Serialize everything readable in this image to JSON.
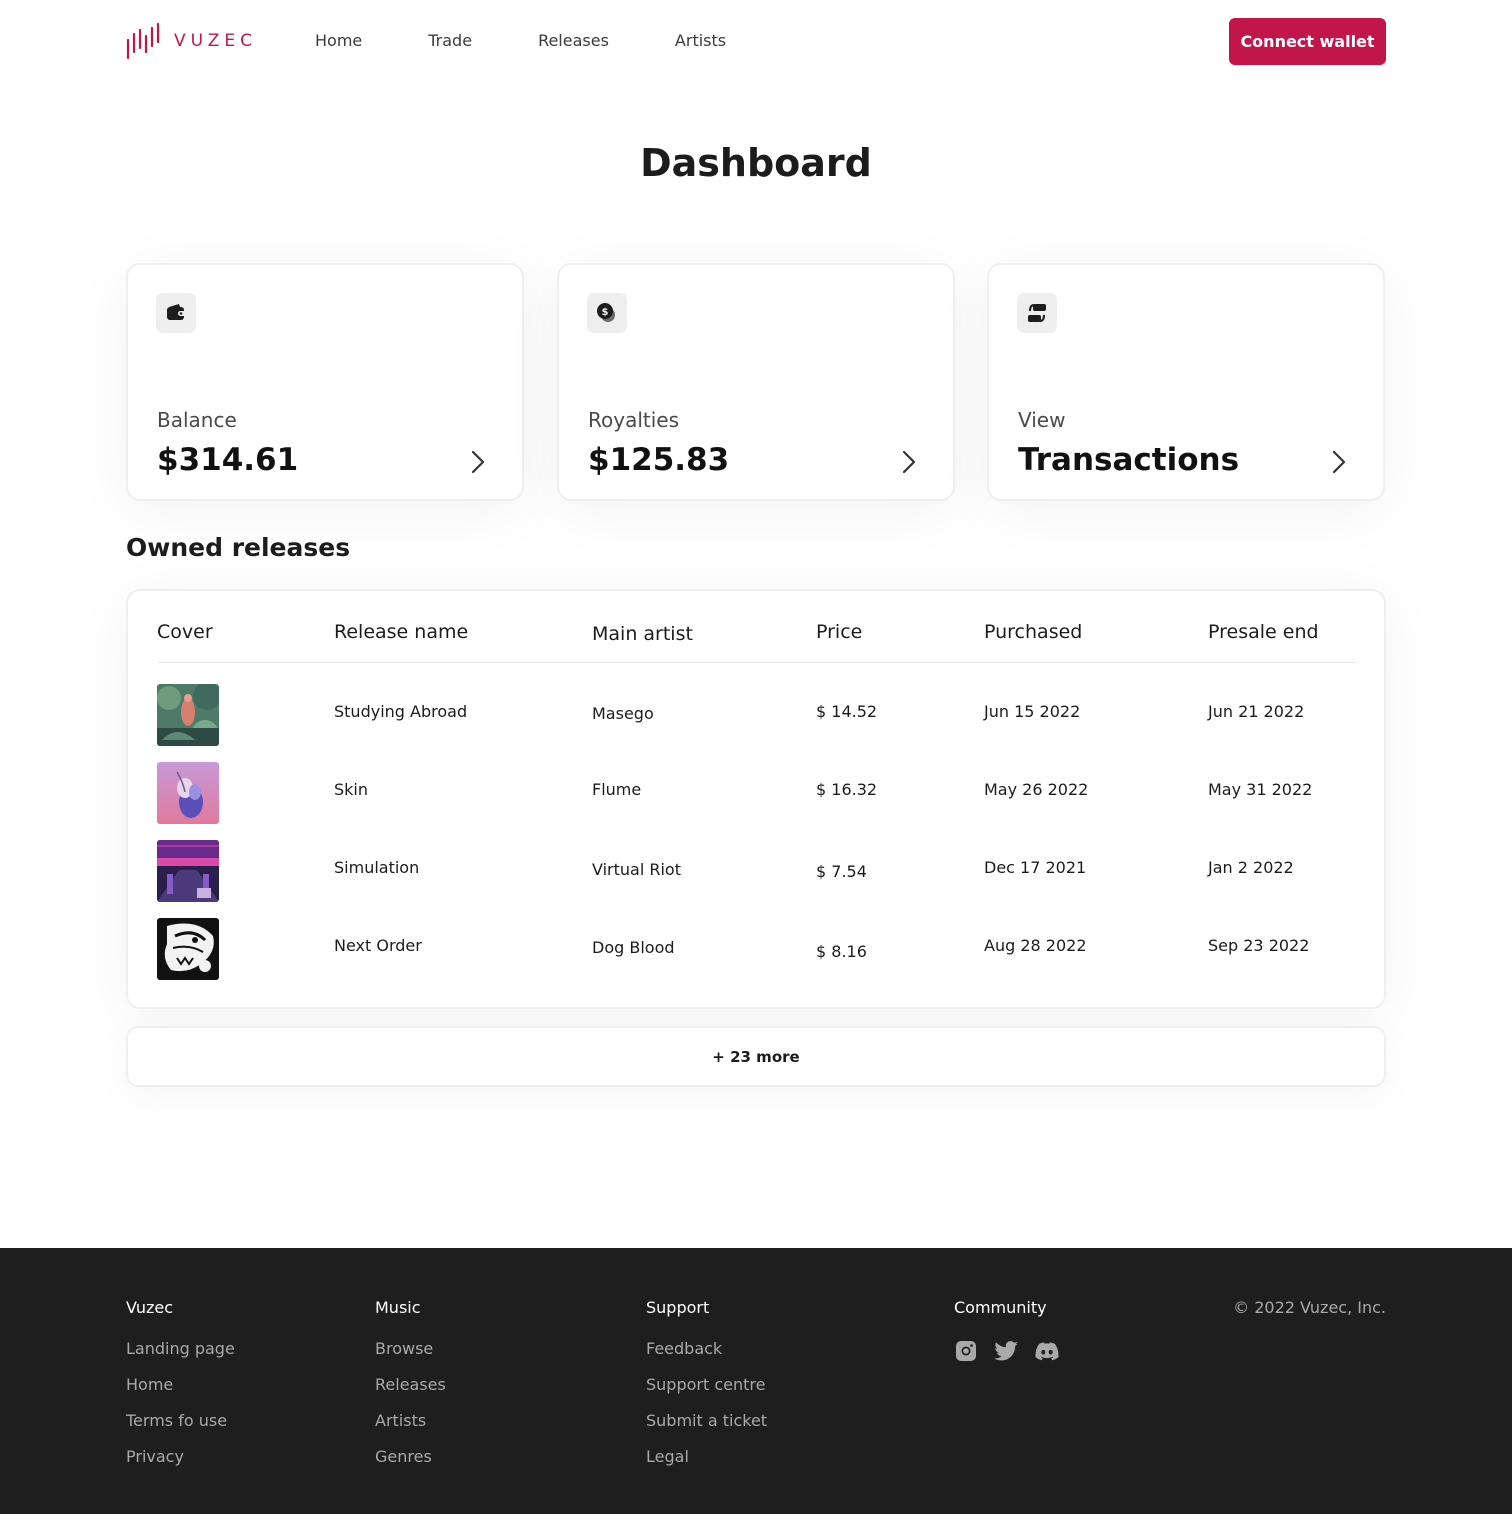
{
  "brand": {
    "name": "VUZEC",
    "accent": "#c2164a"
  },
  "nav": {
    "items": [
      "Home",
      "Trade",
      "Releases",
      "Artists"
    ]
  },
  "header": {
    "connect_label": "Connect wallet"
  },
  "page": {
    "title": "Dashboard"
  },
  "cards": [
    {
      "icon": "wallet-icon",
      "label": "Balance",
      "value": "$314.61"
    },
    {
      "icon": "dollar-coin-icon",
      "label": "Royalties",
      "value": "$125.83"
    },
    {
      "icon": "exchange-icon",
      "label": "View",
      "value": "Transactions"
    }
  ],
  "releases": {
    "title": "Owned releases",
    "columns": [
      "Cover",
      "Release name",
      "Main artist",
      "Price",
      "Purchased",
      "Presale end"
    ],
    "rows": [
      {
        "name": "Studying Abroad",
        "artist": "Masego",
        "price": "$ 14.52",
        "purchased": "Jun 15 2022",
        "presale_end": "Jun 21 2022"
      },
      {
        "name": "Skin",
        "artist": "Flume",
        "price": "$ 16.32",
        "purchased": "May 26 2022",
        "presale_end": "May 31 2022"
      },
      {
        "name": "Simulation",
        "artist": "Virtual Riot",
        "price": "$ 7.54",
        "purchased": "Dec 17 2021",
        "presale_end": "Jan 2 2022"
      },
      {
        "name": "Next Order",
        "artist": "Dog Blood",
        "price": "$ 8.16",
        "purchased": "Aug 28 2022",
        "presale_end": "Sep 23 2022"
      }
    ],
    "more_label": "+ 23 more"
  },
  "footer": {
    "columns": [
      {
        "title": "Vuzec",
        "links": [
          "Landing page",
          "Home",
          "Terms fo use",
          "Privacy"
        ]
      },
      {
        "title": "Music",
        "links": [
          "Browse",
          "Releases",
          "Artists",
          "Genres"
        ]
      },
      {
        "title": "Support",
        "links": [
          "Feedback",
          "Support centre",
          "Submit a ticket",
          "Legal"
        ]
      }
    ],
    "community": {
      "title": "Community",
      "icons": [
        "instagram-icon",
        "twitter-icon",
        "discord-icon"
      ]
    },
    "copyright": "© 2022 Vuzec, Inc."
  }
}
